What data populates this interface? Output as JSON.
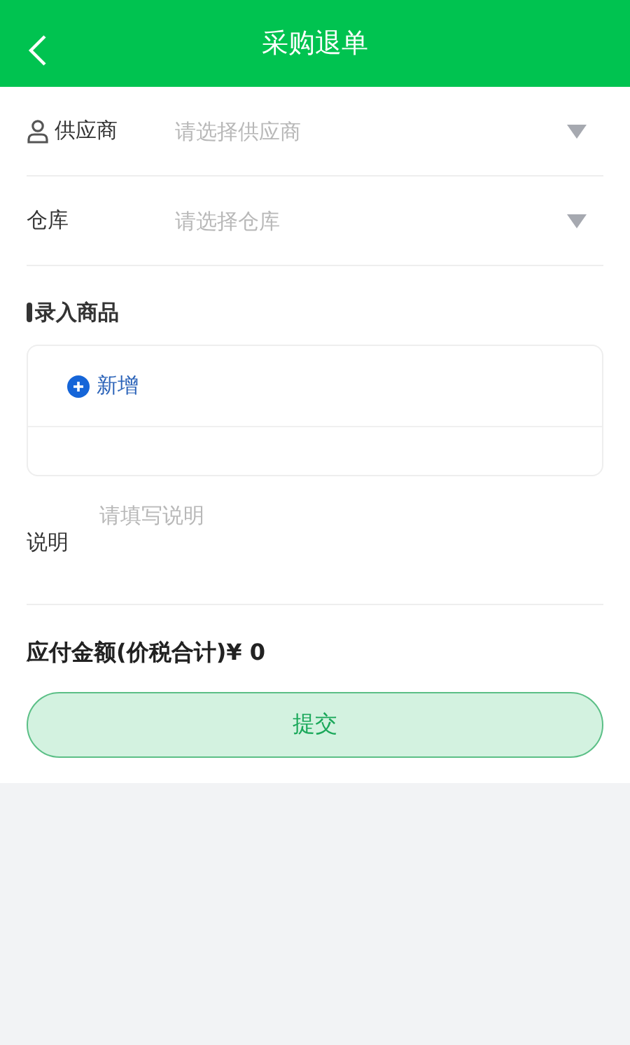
{
  "header": {
    "title": "采购退单"
  },
  "fields": [
    {
      "kind": "select",
      "label": "供应商",
      "placeholder": "请选择供应商",
      "icon": true
    },
    {
      "kind": "select",
      "label": "仓库",
      "placeholder": "请选择仓库",
      "icon": false
    }
  ],
  "goods": {
    "title": "录入商品",
    "add_label": "新增"
  },
  "remark": {
    "label": "说明",
    "placeholder": "请填写说明"
  },
  "amount": "应付金额(价税合计)¥ 0",
  "submit": "提交"
}
